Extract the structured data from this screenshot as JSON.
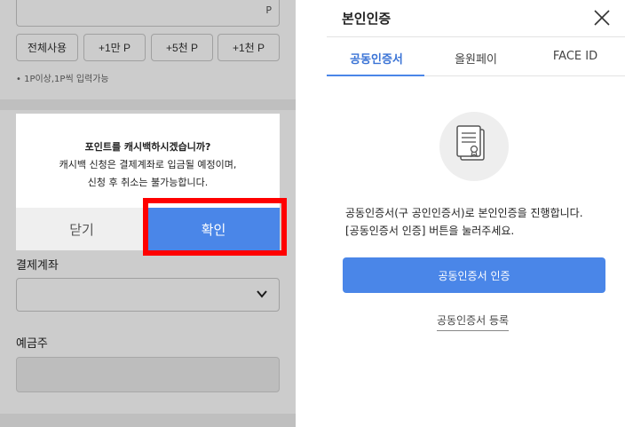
{
  "left": {
    "point_input": {
      "unit": "P"
    },
    "chips": [
      "전체사용",
      "+1만 P",
      "+5천 P",
      "+1천 P"
    ],
    "hint": "• 1P이상,1P씩 입력가능",
    "payment_account_label": "결제계좌",
    "depositor_label": "예금주",
    "dialog": {
      "question": "포인트를 캐시백하시겠습니까?",
      "line2": "캐시백 신청은 결제계좌로 입금될 예정이며,",
      "line3": "신청 후 취소는 불가능합니다.",
      "close_label": "닫기",
      "confirm_label": "확인"
    },
    "highlight_color": "#ff0000"
  },
  "right": {
    "title": "본인인증",
    "tabs": [
      {
        "label": "공동인증서",
        "active": true
      },
      {
        "label": "올원페이",
        "active": false
      },
      {
        "label": "FACE ID",
        "active": false
      }
    ],
    "description_line1": "공동인증서(구 공인인증서)로 본인인증을 진행합니다.",
    "description_line2": "[공동인증서 인증] 버튼을 눌러주세요.",
    "auth_button_label": "공동인증서 인증",
    "register_link_label": "공동인증서 등록",
    "accent_color": "#4a86e8"
  }
}
